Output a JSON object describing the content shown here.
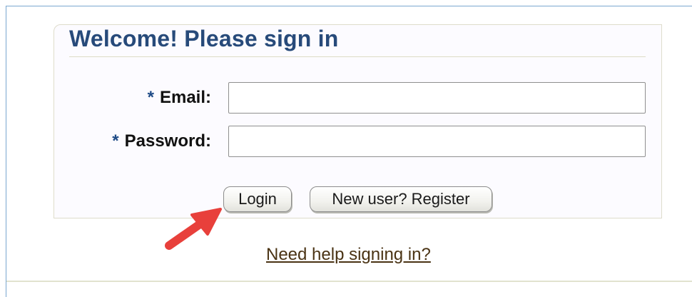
{
  "form": {
    "title": "Welcome! Please sign in",
    "required_marker": "*",
    "email_label": "Email:",
    "email_value": "",
    "password_label": "Password:",
    "password_value": "",
    "login_button": "Login",
    "register_button": "New user? Register",
    "help_link": "Need help signing in?"
  },
  "colors": {
    "title": "#274a7a",
    "annotation_arrow": "#e8403b",
    "link": "#4a3314"
  },
  "icons": {
    "annotation": "red-arrow-icon"
  }
}
